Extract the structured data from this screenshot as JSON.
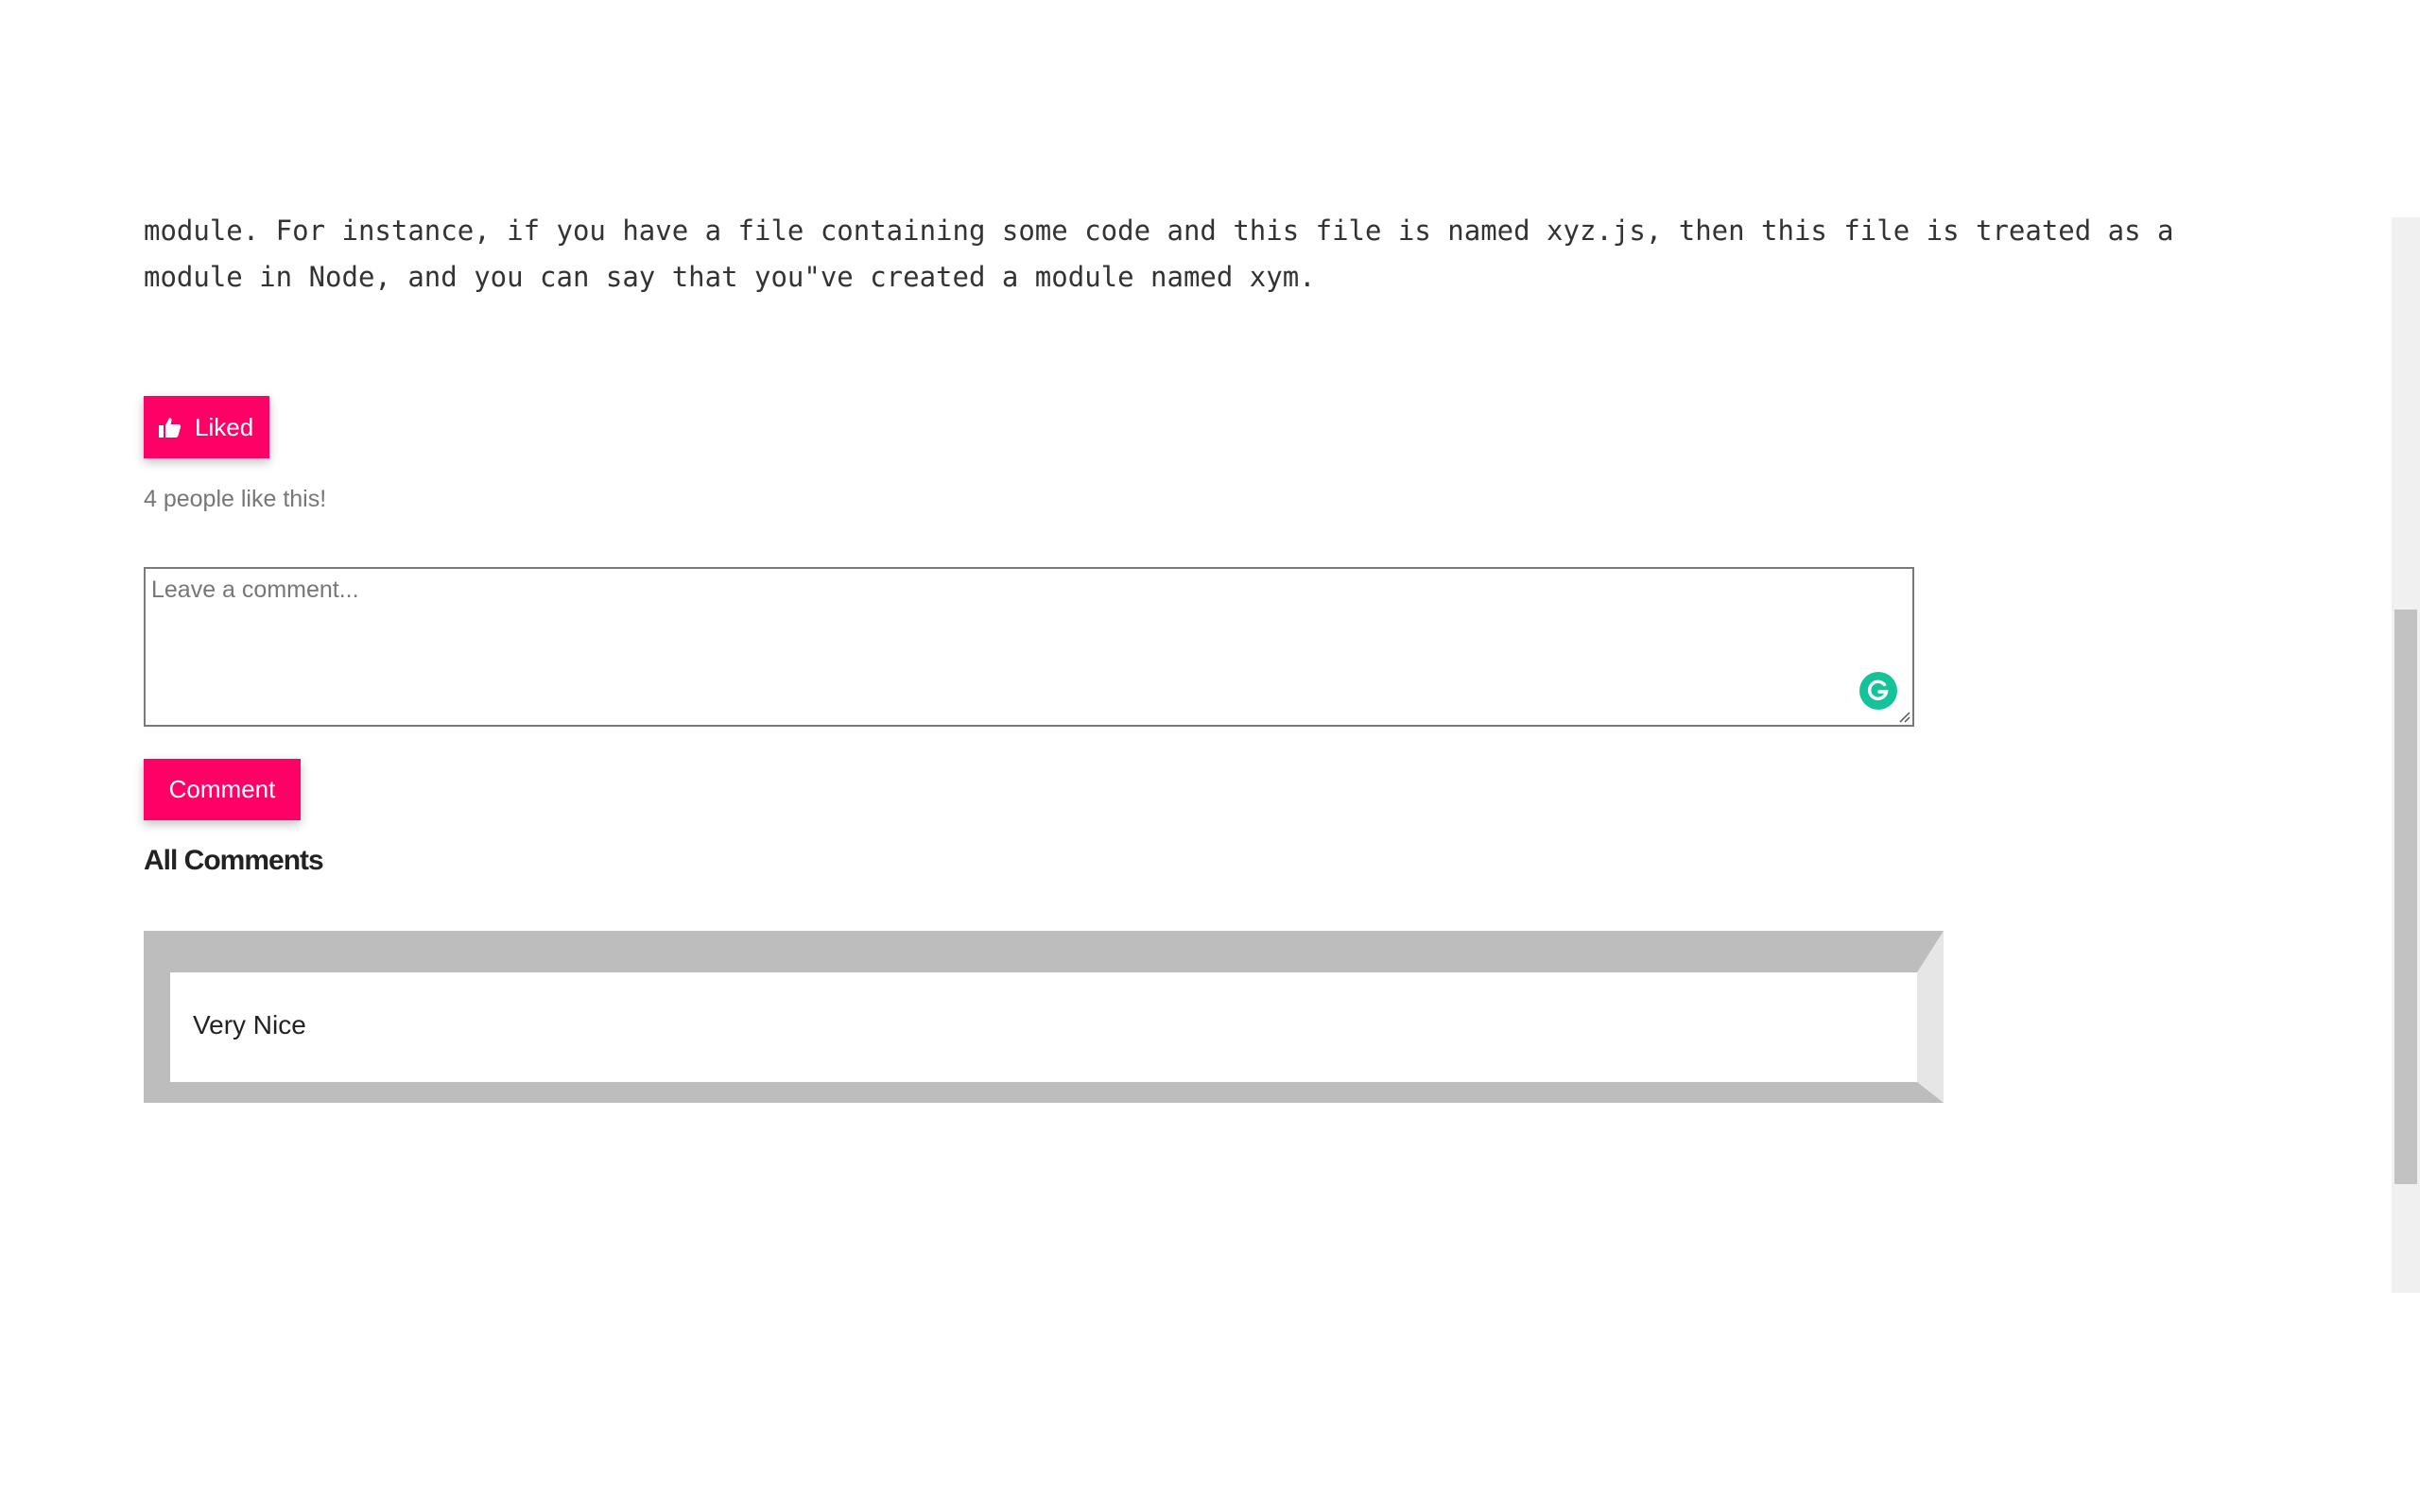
{
  "article": {
    "paragraph": "module. For instance, if you have a file containing some code and this file is named xyz.js, then this file is treated as a module in Node, and you can say that you\"ve created a module named xym."
  },
  "likes": {
    "button_label": "Liked",
    "count_text": "4 people like this!"
  },
  "comment_form": {
    "placeholder": "Leave a comment...",
    "submit_label": "Comment"
  },
  "comments": {
    "heading": "All Comments",
    "items": [
      {
        "text": "Very Nice"
      }
    ]
  },
  "colors": {
    "accent": "#ff0066",
    "grammarly": "#15c39a",
    "comment_border": "#bdbdbd"
  },
  "icons": {
    "like": "thumbs-up-icon",
    "grammar": "grammarly-icon",
    "resize": "resize-handle-icon"
  }
}
